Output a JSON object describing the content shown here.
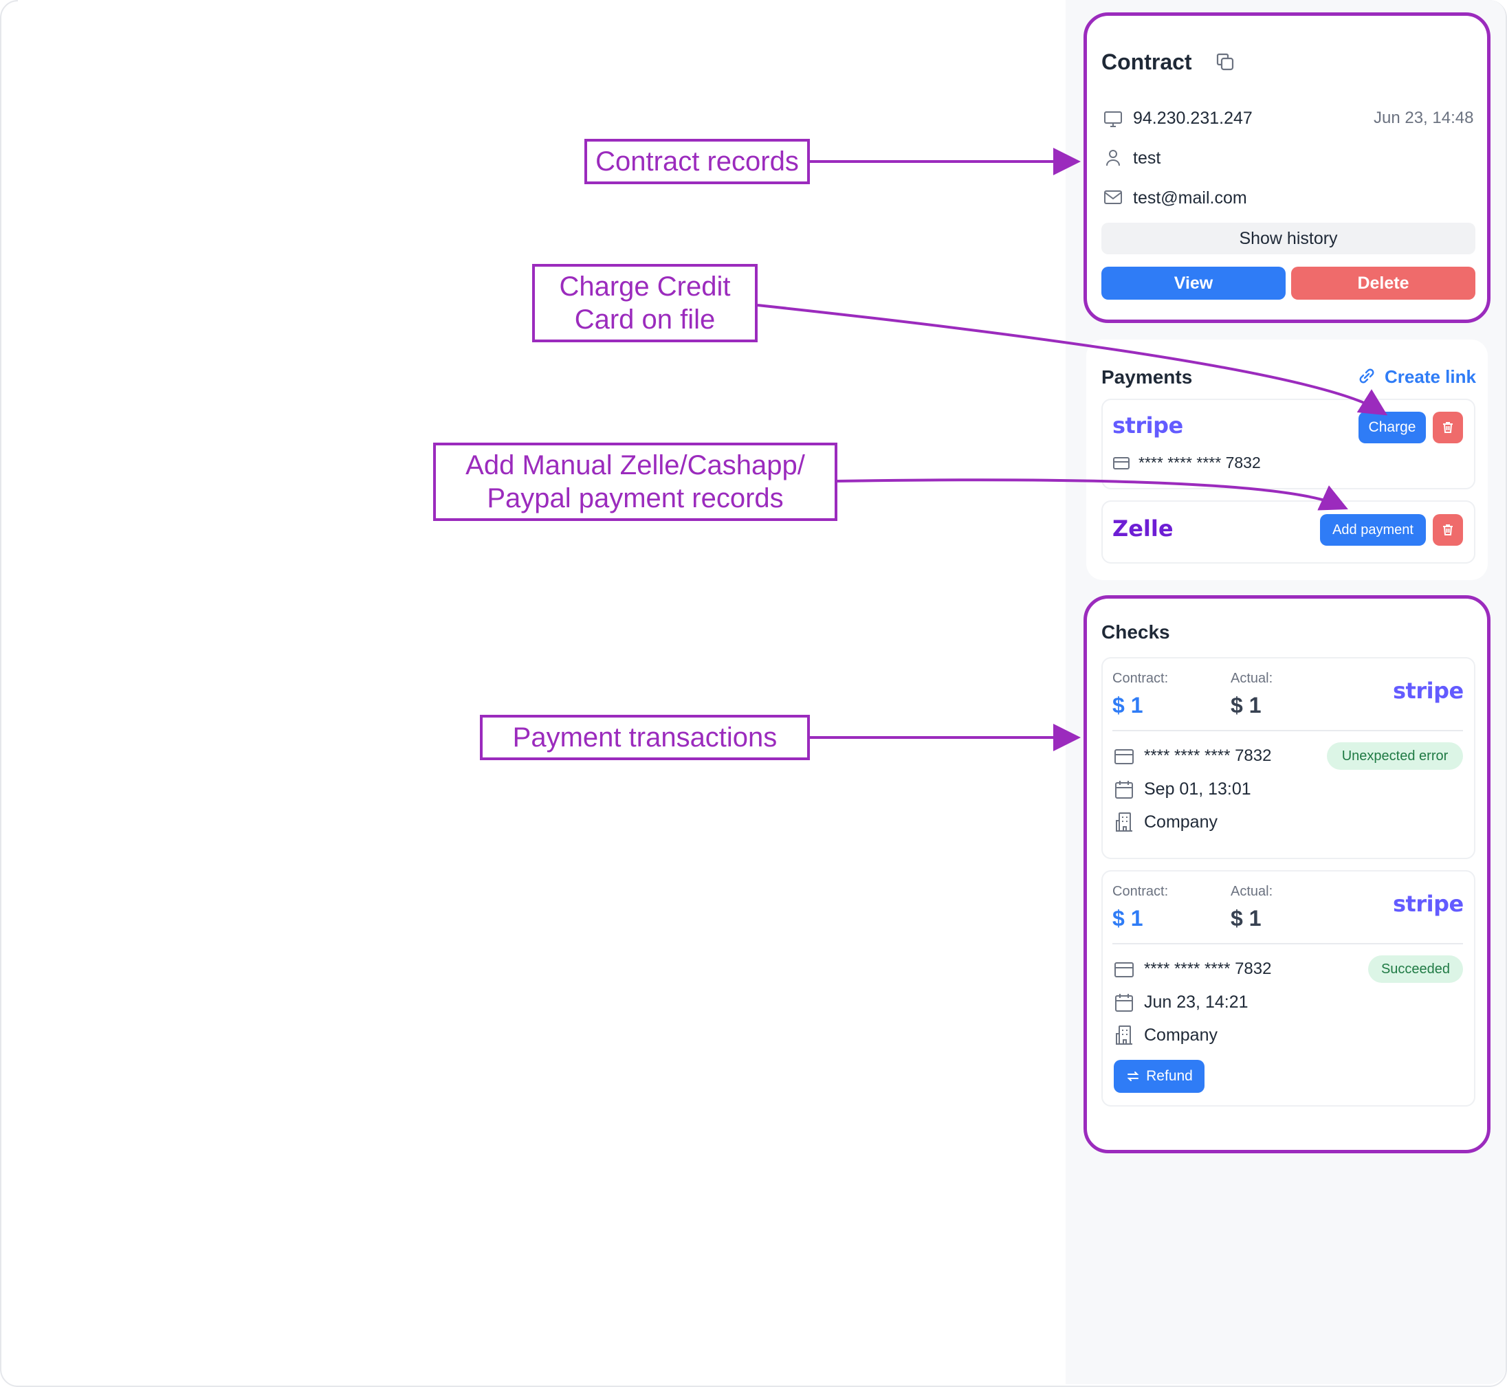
{
  "annotations": {
    "contract_records": "Contract records",
    "charge_line1": "Charge Credit",
    "charge_line2": "Card on file",
    "manual_line1": "Add Manual Zelle/Cashapp/",
    "manual_line2": "Paypal payment records",
    "transactions": "Payment transactions"
  },
  "contract": {
    "title": "Contract",
    "copy_icon": "copy-icon",
    "ip": "94.230.231.247",
    "date": "Jun 23, 14:48",
    "name": "test",
    "email": "test@mail.com",
    "show_history": "Show history",
    "view": "View",
    "delete": "Delete"
  },
  "payments": {
    "title": "Payments",
    "create_link": "Create link",
    "stripe": {
      "logo": "stripe",
      "card": "**** **** **** 7832",
      "charge": "Charge"
    },
    "zelle": {
      "logo": "Zelle",
      "add_payment": "Add payment"
    }
  },
  "checks": {
    "title": "Checks",
    "items": [
      {
        "contract_label": "Contract:",
        "contract_value": "$ 1",
        "actual_label": "Actual:",
        "actual_value": "$ 1",
        "logo": "stripe",
        "card": "**** **** **** 7832",
        "status": "Unexpected error",
        "date": "Sep 01, 13:01",
        "company": "Company"
      },
      {
        "contract_label": "Contract:",
        "contract_value": "$ 1",
        "actual_label": "Actual:",
        "actual_value": "$ 1",
        "logo": "stripe",
        "card": "**** **** **** 7832",
        "status": "Succeeded",
        "date": "Jun 23, 14:21",
        "company": "Company",
        "refund": "Refund"
      }
    ]
  },
  "colors": {
    "accent": "#2f7cf6",
    "danger": "#ef6b6b",
    "annotation": "#9b2bbd",
    "stripe": "#635bff",
    "zelle": "#6d1ed4",
    "success_bg": "#dcf5e6"
  }
}
